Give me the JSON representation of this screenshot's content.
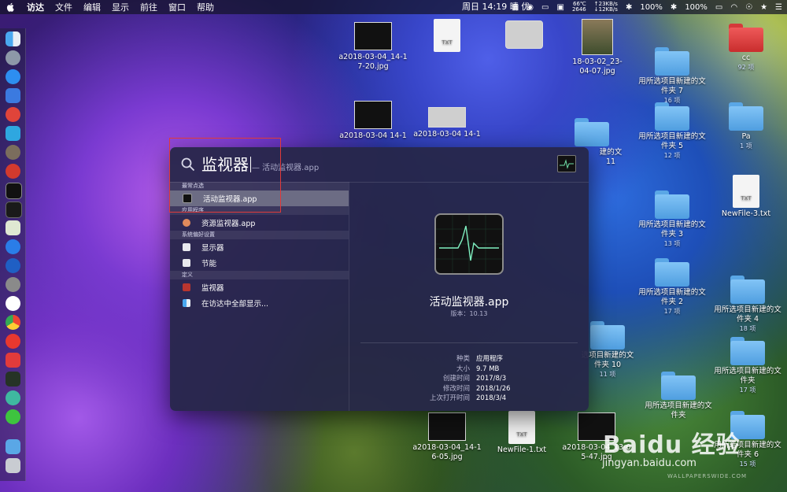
{
  "menubar": {
    "app": "访达",
    "menus": [
      "文件",
      "编辑",
      "显示",
      "前往",
      "窗口",
      "帮助"
    ],
    "temp": "66℃",
    "cpu": "2646",
    "net_up": "↑23KB/s",
    "net_down": "↓12KB/s",
    "clock": "周日 14:19",
    "weather": "晴",
    "air": "优",
    "battery1": "100%",
    "battery2": "100%"
  },
  "spotlight": {
    "query": "监视器",
    "hint": "— 活动监视器.app",
    "sections": {
      "top_hit": "最常点选",
      "apps": "应用程序",
      "prefs": "系统偏好设置",
      "definition": "定义"
    },
    "results": {
      "activity_monitor": "活动监视器.app",
      "resource_monitor": "资源监视器.app",
      "displays": "显示器",
      "energy_saver": "节能",
      "dictionary": "监视器",
      "show_all": "在访达中全部显示..."
    },
    "detail": {
      "name": "活动监视器.app",
      "version": "版本：10.13",
      "meta": [
        {
          "k": "种类",
          "v": "应用程序"
        },
        {
          "k": "大小",
          "v": "9.7 MB"
        },
        {
          "k": "创建时间",
          "v": "2017/8/3"
        },
        {
          "k": "修改时间",
          "v": "2018/1/26"
        },
        {
          "k": "上次打开时间",
          "v": "2018/3/4"
        }
      ]
    }
  },
  "desktop": {
    "f_a1": "a2018-03-04_14-1",
    "f_a1b": "7-20.jpg",
    "f_a2": "a2018-03-04 14-1",
    "f_a3": "a2018-03-04 14-1",
    "f_18": "18-03-02_23-",
    "f_18b": "04-07.jpg",
    "f_cc": "cc",
    "f_cc_sub": "92 项",
    "f_pa": "Pa",
    "f_pa_sub": "1 项",
    "f_nf3": "NewFile-3.txt",
    "txt": "TXT",
    "fold7a": "用所选项目新建的文",
    "fold7b": "件夹 7",
    "fold7s": "16 项",
    "fold5a": "用所选项目新建的文",
    "fold5b": "件夹 5",
    "fold5s": "12 项",
    "fold11a": "建的文",
    "fold11b": "11",
    "fold3a": "用所选项目新建的文",
    "fold3b": "件夹 3",
    "fold3s": "13 项",
    "fold2a": "用所选项目新建的文",
    "fold2b": "件夹 2",
    "fold2s": "17 项",
    "fold4a": "用所选项目新建的文",
    "fold4b": "件夹 4",
    "fold4s": "18 项",
    "fold10a": "选项目新建的文",
    "fold10b": "件夹 10",
    "fold10s": "11 项",
    "folda": "用所选项目新建的文",
    "foldb": "件夹",
    "folds": "17 项",
    "fold_x": "用所选项目新建的文",
    "fold_x2": "件夹",
    "fold6a": "用所选项目新建的文",
    "fold6b": "件夹 6",
    "fold6s": "15 项",
    "f_b1": "a2018-03-04_14-1",
    "f_b1b": "6-05.jpg",
    "f_nf1": "NewFile-1.txt",
    "f_b2": "a2018-03-04_13-0",
    "f_b2b": "5-47.jpg"
  },
  "watermark": {
    "brand": "Baidu 经验",
    "url": "jingyan.baidu.com",
    "wp": "WALLPAPERSWIDE.COM"
  },
  "colors": {
    "selection": "#6c6c84",
    "panel": "#26264a",
    "highlight_box": "#e03a3a"
  }
}
